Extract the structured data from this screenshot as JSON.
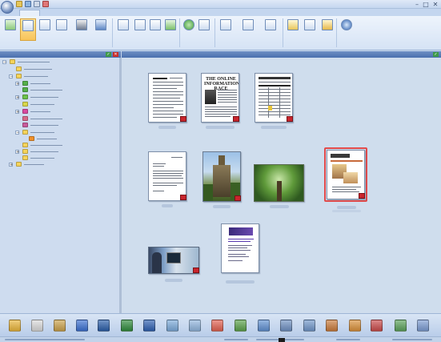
{
  "window": {
    "title": "",
    "controls": {
      "minimize": "–",
      "maximize": "□",
      "close": "✕"
    },
    "quick_access_icons": [
      "save-icon",
      "open-icon",
      "undo-icon",
      "redo-icon"
    ]
  },
  "tabs": [
    {
      "label": "",
      "active": true
    },
    {
      "label": "",
      "active": false
    },
    {
      "label": "",
      "active": false
    },
    {
      "label": "",
      "active": false
    },
    {
      "label": "",
      "active": false
    }
  ],
  "ribbon": {
    "buttons": [
      {
        "name": "back-button",
        "label": "",
        "icon": "arrow-left-icon",
        "selected": false
      },
      {
        "name": "desktop-view-button",
        "label": "",
        "icon": "desktop-icon",
        "selected": true
      },
      {
        "name": "scan-button",
        "label": "",
        "icon": "scanner-icon",
        "selected": false
      },
      {
        "name": "folder-button",
        "label": "",
        "icon": "folder-icon",
        "selected": false
      },
      {
        "name": "print-button",
        "label": "",
        "icon": "printer-icon",
        "selected": false
      },
      {
        "name": "send-button",
        "label": "",
        "icon": "send-icon",
        "selected": false
      },
      {
        "name": "new-doc-button",
        "label": "",
        "icon": "document-icon",
        "selected": false
      },
      {
        "name": "edit-button",
        "label": "",
        "icon": "edit-icon",
        "selected": false
      },
      {
        "name": "annotate-button",
        "label": "",
        "icon": "annotate-icon",
        "selected": false
      },
      {
        "name": "properties-button",
        "label": "",
        "icon": "properties-icon",
        "selected": false
      },
      {
        "name": "ocr-button",
        "label": "",
        "icon": "ocr-icon",
        "selected": false
      },
      {
        "name": "convert-button",
        "label": "",
        "icon": "convert-icon",
        "selected": false
      },
      {
        "name": "layout-button",
        "label": "",
        "icon": "layout-icon",
        "selected": false
      },
      {
        "name": "compare-button",
        "label": "",
        "icon": "compare-icon",
        "selected": false
      },
      {
        "name": "combine-button",
        "label": "",
        "icon": "combine-icon",
        "selected": false
      },
      {
        "name": "notes-button",
        "label": "",
        "icon": "notes-icon",
        "selected": false
      },
      {
        "name": "stamp-button",
        "label": "",
        "icon": "stamp-icon",
        "selected": false
      },
      {
        "name": "export-button",
        "label": "",
        "icon": "export-icon",
        "selected": false
      },
      {
        "name": "search-button",
        "label": "",
        "icon": "search-icon",
        "selected": false
      }
    ],
    "groups": [
      "",
      "",
      "",
      "",
      "",
      "",
      ""
    ]
  },
  "left_pane": {
    "header": "",
    "tree": [
      {
        "label": "",
        "color": "#f5d35a",
        "level": 0,
        "expander": "−"
      },
      {
        "label": "",
        "color": "#f5d35a",
        "level": 1,
        "expander": ""
      },
      {
        "label": "",
        "color": "#f5d35a",
        "level": 1,
        "expander": "−"
      },
      {
        "label": "",
        "color": "#55b04a",
        "level": 2,
        "expander": "+"
      },
      {
        "label": "",
        "color": "#55b04a",
        "level": 2,
        "expander": ""
      },
      {
        "label": "",
        "color": "#6cc24a",
        "level": 2,
        "expander": "+"
      },
      {
        "label": "",
        "color": "#d8d64a",
        "level": 2,
        "expander": ""
      },
      {
        "label": "",
        "color": "#d84aa0",
        "level": 2,
        "expander": "+"
      },
      {
        "label": "",
        "color": "#d86a8a",
        "level": 2,
        "expander": ""
      },
      {
        "label": "",
        "color": "#c85a9a",
        "level": 2,
        "expander": ""
      },
      {
        "label": "",
        "color": "#f5d35a",
        "level": 2,
        "expander": "−"
      },
      {
        "label": "",
        "color": "#f0902a",
        "level": 3,
        "expander": ""
      },
      {
        "label": "",
        "color": "#f5d35a",
        "level": 2,
        "expander": ""
      },
      {
        "label": "",
        "color": "#f5d35a",
        "level": 2,
        "expander": "+"
      },
      {
        "label": "",
        "color": "#f5d35a",
        "level": 2,
        "expander": ""
      },
      {
        "label": "",
        "color": "#f5d35a",
        "level": 1,
        "expander": "+"
      }
    ]
  },
  "right_pane": {
    "header": "",
    "items": [
      {
        "kind": "form",
        "caption": "",
        "pdf": true,
        "selected": false
      },
      {
        "kind": "article",
        "caption": "",
        "pdf": true,
        "selected": false,
        "headline": "THE ONLINE INFORMATION RACE"
      },
      {
        "kind": "spreadsheet",
        "caption": "",
        "pdf": true,
        "selected": false
      },
      {
        "kind": "letter",
        "caption": "",
        "pdf": true,
        "selected": false
      },
      {
        "kind": "photo-building",
        "caption": "",
        "pdf": true,
        "selected": false
      },
      {
        "kind": "photo-tree",
        "caption": "",
        "pdf": false,
        "selected": false
      },
      {
        "kind": "brochure",
        "caption": "",
        "pdf": true,
        "selected": true
      },
      {
        "kind": "photo-person",
        "caption": "",
        "pdf": true,
        "selected": false
      },
      {
        "kind": "flyer",
        "caption": "",
        "pdf": false,
        "selected": false
      }
    ]
  },
  "bottom_toolbar": {
    "icons": [
      {
        "name": "folder-app-icon",
        "color": "#e8b43a",
        "glyph": ""
      },
      {
        "name": "pdf-app-icon",
        "color": "#d8d8d8",
        "glyph": ""
      },
      {
        "name": "brush-app-icon",
        "color": "#c9a04a",
        "glyph": ""
      },
      {
        "name": "dpf-app-icon",
        "color": "#3a6fd0",
        "glyph": ""
      },
      {
        "name": "photoshop-app-icon",
        "color": "#2a5da8",
        "glyph": ""
      },
      {
        "name": "excel-app-icon",
        "color": "#2f8a3c",
        "glyph": ""
      },
      {
        "name": "word-app-icon",
        "color": "#2d5fb0",
        "glyph": ""
      },
      {
        "name": "notepad-app-icon",
        "color": "#7aa9d8",
        "glyph": ""
      },
      {
        "name": "scanner-app-icon",
        "color": "#8fb4dc",
        "glyph": ""
      },
      {
        "name": "acrobat-app-icon",
        "color": "#e06050",
        "glyph": ""
      },
      {
        "name": "globe-app-icon",
        "color": "#5aa04a",
        "glyph": ""
      },
      {
        "name": "ftp-app-icon",
        "color": "#5f8fd0",
        "glyph": ""
      },
      {
        "name": "printer-app-icon",
        "color": "#6d8fc0",
        "glyph": ""
      },
      {
        "name": "ocr-app-icon",
        "color": "#6f95c8",
        "glyph": ""
      },
      {
        "name": "hexagon-app-icon",
        "color": "#c87a3a",
        "glyph": ""
      },
      {
        "name": "users-app-icon",
        "color": "#d8903a",
        "glyph": ""
      },
      {
        "name": "people-app-icon",
        "color": "#c84a4a",
        "glyph": ""
      },
      {
        "name": "recycle-app-icon",
        "color": "#5aa05a",
        "glyph": ""
      },
      {
        "name": "mail-app-icon",
        "color": "#7a9ad0",
        "glyph": ""
      }
    ]
  },
  "status": {
    "text": ""
  }
}
